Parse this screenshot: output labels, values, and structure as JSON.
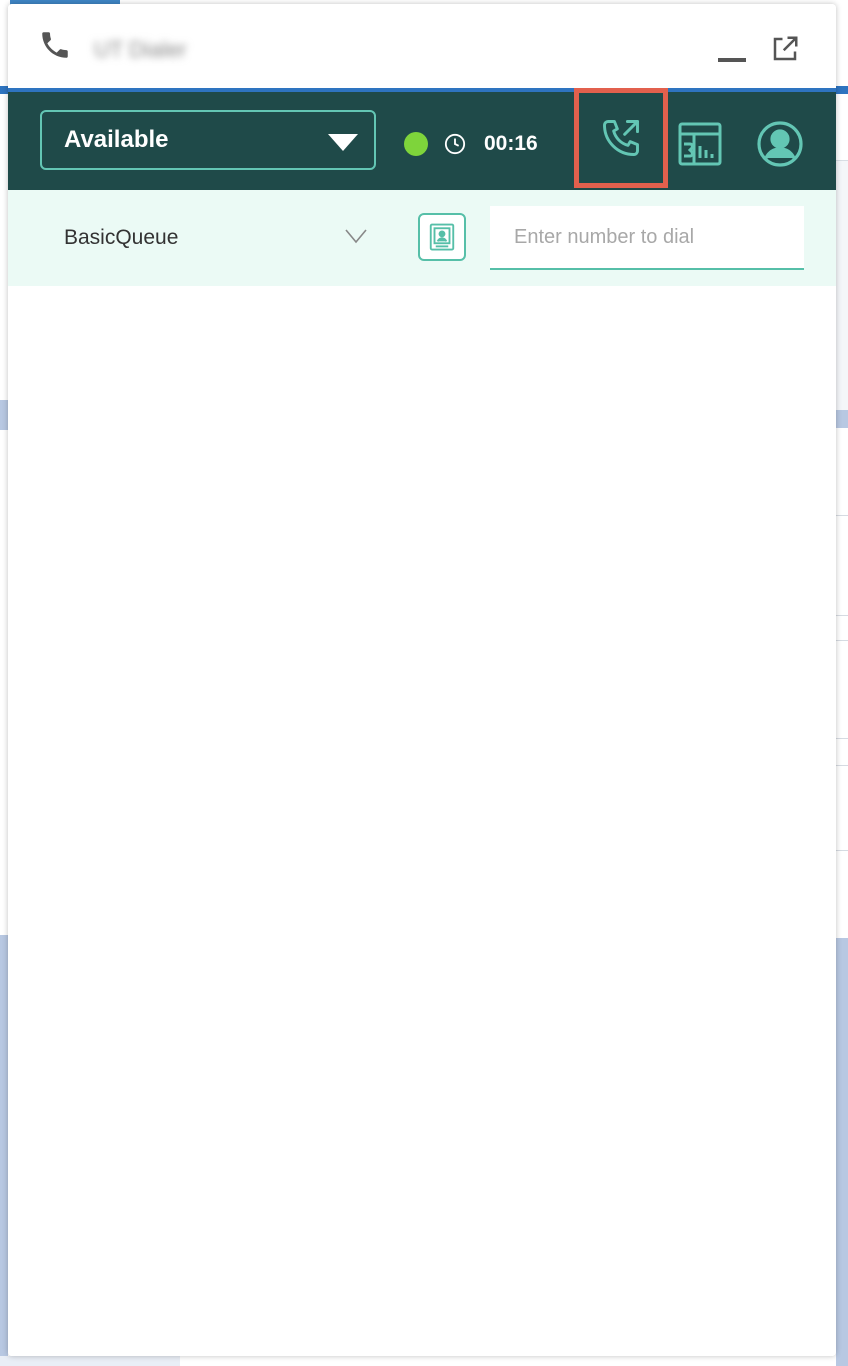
{
  "window": {
    "title": "UT Dialer",
    "minimize_label": "",
    "popout_label": ""
  },
  "toolbar": {
    "status_value": "Available",
    "timer": "00:16",
    "status_color": "#7ed43b"
  },
  "dialer": {
    "queue_value": "BasicQueue",
    "number_placeholder": "Enter number to dial",
    "number_value": ""
  },
  "theme": {
    "toolbar_bg": "#1f4a49",
    "accent": "#63c6b4",
    "highlight": "#e2604d"
  },
  "icons": {
    "title": "phone-icon",
    "popout": "popout-icon",
    "clock": "clock-icon",
    "outbound": "outbound-call-icon",
    "stats": "stats-icon",
    "profile": "user-profile-icon",
    "contacts": "contacts-icon",
    "queue_caret": "chevron-down-icon"
  }
}
